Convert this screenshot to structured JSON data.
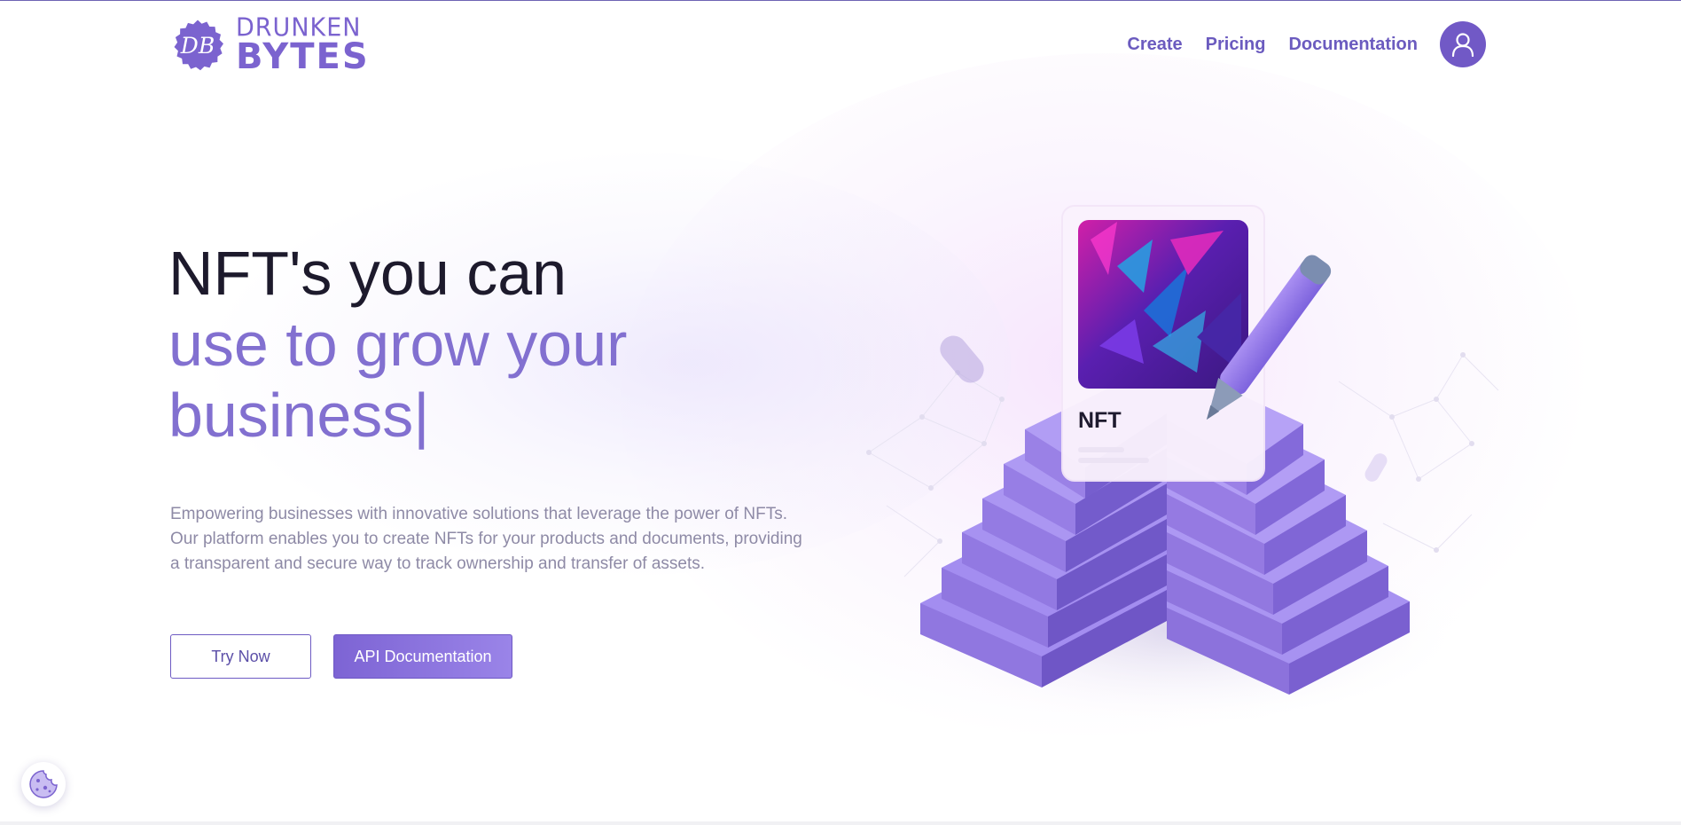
{
  "brand": {
    "badge": "DB",
    "name_line1": "DRUNKEN",
    "name_line2": "BYTES",
    "accent_color": "#7159c6"
  },
  "nav": {
    "items": [
      {
        "label": "Create"
      },
      {
        "label": "Pricing"
      },
      {
        "label": "Documentation"
      }
    ],
    "account_icon": "user-icon"
  },
  "hero": {
    "title_line1": "NFT's you can",
    "title_line2": "use to grow your",
    "title_line3": "business",
    "cursor": "|",
    "description": "Empowering businesses with innovative solutions that leverage the power of NFTs. Our platform enables you to create NFTs for your products and documents, providing a transparent and secure way to track ownership and transfer of assets.",
    "primary_button": "Try Now",
    "secondary_button": "API Documentation"
  },
  "illustration": {
    "card_label": "NFT"
  },
  "cookie_widget": {
    "icon": "cookie-icon"
  }
}
